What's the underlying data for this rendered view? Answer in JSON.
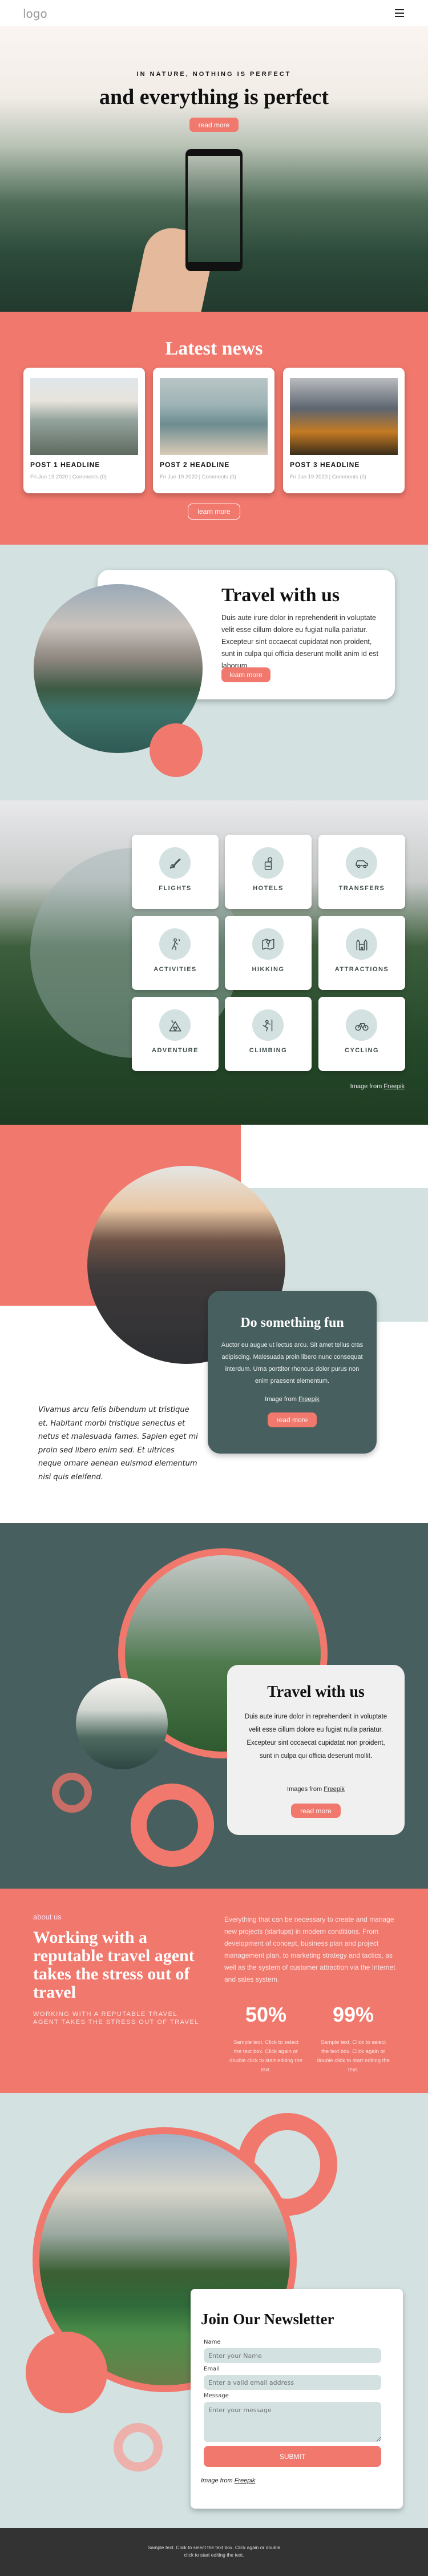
{
  "header": {
    "logo": "logo",
    "menu_icon": "hamburger-icon"
  },
  "hero": {
    "kicker": "IN NATURE, NOTHING IS PERFECT",
    "title": "and everything is perfect",
    "button": "read more"
  },
  "news": {
    "title": "Latest news",
    "posts": [
      {
        "headline": "POST 1 HEADLINE",
        "date": "Fri Jun 19 2020",
        "comments": "Comments (0)"
      },
      {
        "headline": "POST 2 HEADLINE",
        "date": "Fri Jun 19 2020",
        "comments": "Comments (0)"
      },
      {
        "headline": "POST 3 HEADLINE",
        "date": "Fri Jun 19 2020",
        "comments": "Comments (0)"
      }
    ],
    "separator": "|",
    "button": "learn more"
  },
  "travel": {
    "title": "Travel with us",
    "body": "Duis aute irure dolor in reprehenderit in voluptate velit esse cillum dolore eu fugiat nulla pariatur. Excepteur sint occaecat cupidatat non proident, sunt in culpa qui officia deserunt mollit anim id est laborum.",
    "button": "learn more"
  },
  "services": {
    "items": [
      {
        "label": "FLIGHTS",
        "icon": "airplane-icon"
      },
      {
        "label": "HOTELS",
        "icon": "door-hanger-icon"
      },
      {
        "label": "TRANSFERS",
        "icon": "car-icon"
      },
      {
        "label": "ACTIVITIES",
        "icon": "hiker-icon"
      },
      {
        "label": "HIKKING",
        "icon": "map-pin-icon"
      },
      {
        "label": "ATTRACTIONS",
        "icon": "castle-icon"
      },
      {
        "label": "ADVENTURE",
        "icon": "tent-icon"
      },
      {
        "label": "CLIMBING",
        "icon": "climber-icon"
      },
      {
        "label": "CYCLING",
        "icon": "bicycle-icon"
      }
    ],
    "credit_prefix": "Image from",
    "credit_link": "Freepik"
  },
  "fun": {
    "title": "Do something fun",
    "body": "Auctor eu augue ut lectus arcu. Sit amet tellus cras adipiscing. Malesuada proin libero nunc consequat interdum. Urna porttitor rhoncus dolor purus non enim praesent elementum.",
    "credit_prefix": "Image from",
    "credit_link": "Freepik",
    "button": "read more",
    "quote": "Vivamus arcu felis bibendum ut tristique et. Habitant morbi tristique senectus et netus et malesuada fames. Sapien eget mi proin sed libero enim sed. Et ultrices neque ornare aenean euismod elementum nisi quis eleifend."
  },
  "travel2": {
    "title": "Travel with us",
    "body": "Duis aute irure dolor in reprehenderit in voluptate velit esse cillum dolore eu fugiat nulla pariatur. Excepteur sint occaecat cupidatat non proident, sunt in culpa qui officia deserunt mollit.",
    "credit_prefix": "Images from",
    "credit_link": "Freepik",
    "button": "read more"
  },
  "about": {
    "kicker": "about us",
    "title": "Working with a reputable travel agent takes the stress out of travel",
    "subtitle": "WORKING WITH A REPUTABLE TRAVEL AGENT TAKES THE STRESS OUT OF TRAVEL",
    "body": "Everything that can be necessary to create and manage new projects (startups) in modern conditions. From development of concept, business plan and project management plan, to marketing strategy and tactics, as well as the system of customer attraction via the Internet and sales system.",
    "stats": [
      {
        "value": "50%",
        "text": "Sample text. Click to select the text box. Click again or double click to start editing the text."
      },
      {
        "value": "99%",
        "text": "Sample text. Click to select the text box. Click again or double click to start editing the text."
      }
    ]
  },
  "newsletter": {
    "title": "Join Our Newsletter",
    "name_label": "Name",
    "name_placeholder": "Enter your Name",
    "email_label": "Email",
    "email_placeholder": "Enter a valid email address",
    "message_label": "Message",
    "message_placeholder": "Enter your message",
    "submit": "SUBMIT",
    "credit_prefix": "Image from",
    "credit_link": "Freepik"
  },
  "footer": {
    "text": "Sample text. Click to select the text box. Click again or double click to start editing the text."
  },
  "colors": {
    "coral": "#f1786d",
    "dark_teal": "#475f5e",
    "light_blue": "#d3e1e1",
    "footer": "#333333"
  }
}
